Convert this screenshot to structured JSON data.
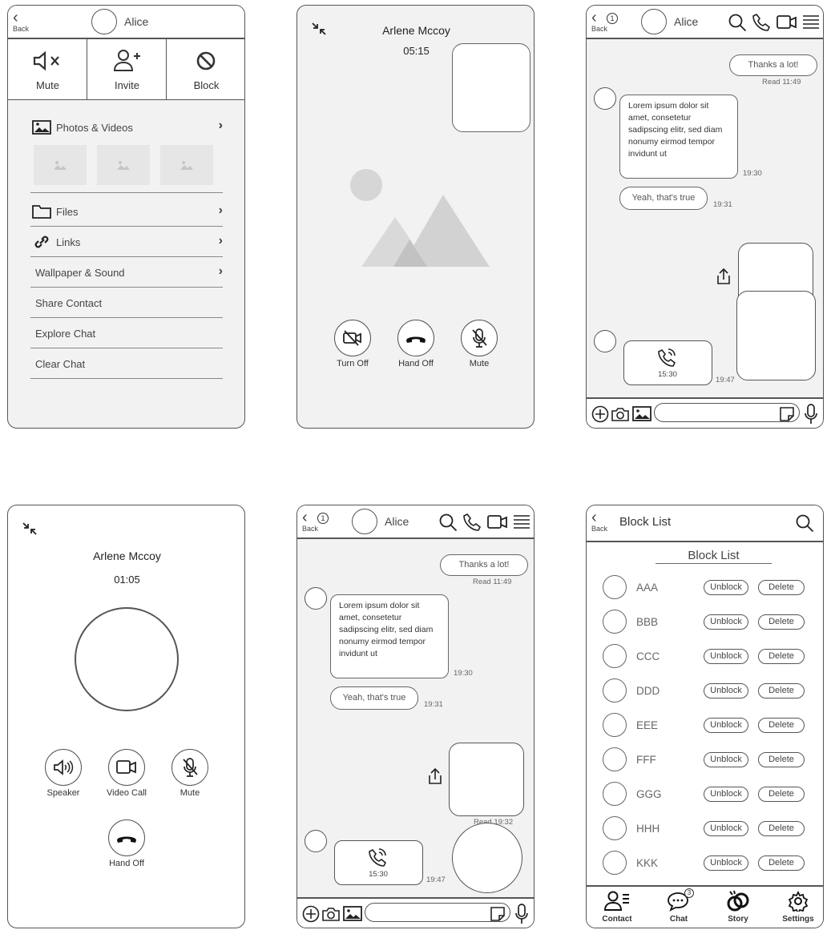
{
  "screen1": {
    "back_label": "Back",
    "contact_name": "Alice",
    "actions": [
      {
        "icon": "mute-icon",
        "label": "Mute"
      },
      {
        "icon": "invite-icon",
        "label": "Invite"
      },
      {
        "icon": "block-icon",
        "label": "Block"
      }
    ],
    "menu": {
      "photos": "Photos & Videos",
      "files": "Files",
      "links": "Links",
      "wallpaper": "Wallpaper & Sound",
      "share": "Share Contact",
      "explore": "Explore Chat",
      "clear": "Clear Chat"
    }
  },
  "screen2": {
    "caller": "Arlene Mccoy",
    "timer": "05:15",
    "buttons": [
      {
        "icon": "camera-off-icon",
        "label": "Turn Off"
      },
      {
        "icon": "hang-up-icon",
        "label": "Hand Off"
      },
      {
        "icon": "mic-off-icon",
        "label": "Mute"
      }
    ]
  },
  "screen3": {
    "back_label": "Back",
    "badge": "1",
    "contact_name": "Alice",
    "messages": {
      "sent1": "Thanks a lot!",
      "sent1_meta": "Read  11:49",
      "recv1": "Lorem ipsum dolor sit amet, consetetur sadipscing elitr, sed diam nonumy eirmod tempor invidunt ut",
      "recv1_time": "19:30",
      "recv2": "Yeah, that's true",
      "recv2_time": "19:31",
      "call_time": "15:30",
      "call_meta": "19:47"
    }
  },
  "screen4": {
    "caller": "Arlene Mccoy",
    "timer": "01:05",
    "buttons": [
      {
        "icon": "speaker-icon",
        "label": "Speaker"
      },
      {
        "icon": "video-call-icon",
        "label": "Video Call"
      },
      {
        "icon": "mic-off-icon",
        "label": "Mute"
      },
      {
        "icon": "hang-up-icon",
        "label": "Hand Off"
      }
    ]
  },
  "screen5": {
    "back_label": "Back",
    "badge": "1",
    "contact_name": "Alice",
    "messages": {
      "sent1": "Thanks a lot!",
      "sent1_meta": "Read  11:49",
      "recv1": "Lorem ipsum dolor sit amet, consetetur sadipscing elitr, sed diam nonumy eirmod tempor invidunt ut",
      "recv1_time": "19:30",
      "recv2": "Yeah, that's true",
      "recv2_time": "19:31",
      "image_meta": "Read  19:32",
      "call_time": "15:30",
      "call_meta": "19:47"
    }
  },
  "screen6": {
    "back_label": "Back",
    "title": "Block List",
    "section_title": "Block List",
    "unblock_label": "Unblock",
    "delete_label": "Delete",
    "rows": [
      "AAA",
      "BBB",
      "CCC",
      "DDD",
      "EEE",
      "FFF",
      "GGG",
      "HHH",
      "KKK"
    ],
    "tabs": [
      {
        "icon": "contact-icon",
        "label": "Contact"
      },
      {
        "icon": "chat-icon",
        "label": "Chat",
        "badge": "3"
      },
      {
        "icon": "story-icon",
        "label": "Story"
      },
      {
        "icon": "settings-icon",
        "label": "Settings"
      }
    ]
  },
  "colors": {
    "stroke": "#555555",
    "panel_gray": "#f2f2f2"
  }
}
